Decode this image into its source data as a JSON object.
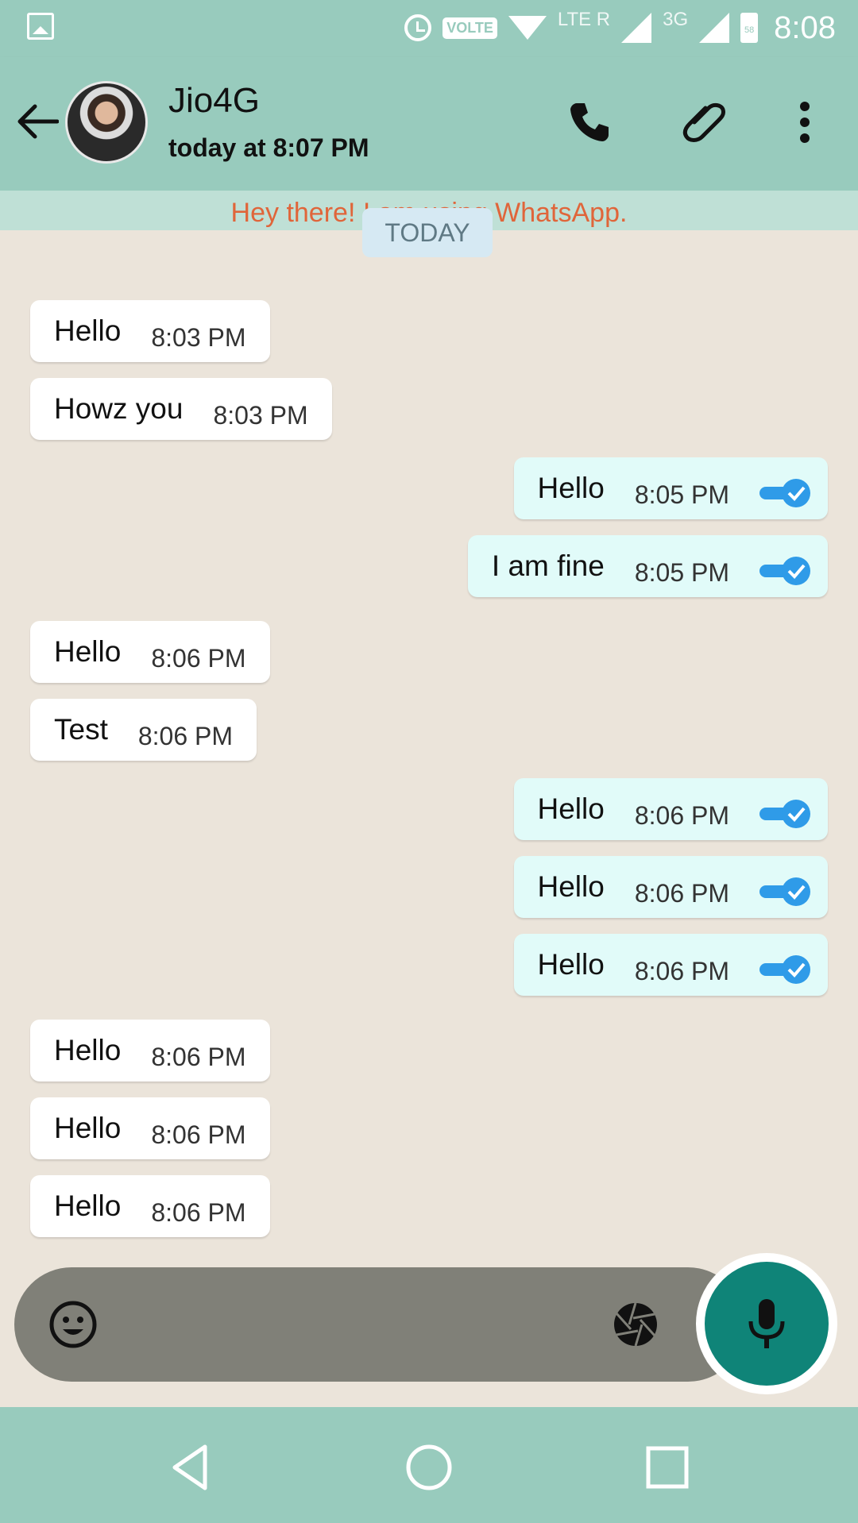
{
  "status_bar": {
    "volte": "VOLTE",
    "lte": "LTE R",
    "network": "3G",
    "battery": "58",
    "time": "8:08"
  },
  "header": {
    "contact_name": "Jio4G",
    "last_seen": "today at 8:07 PM"
  },
  "banner": "Hey there! I am using WhatsApp.",
  "date_chip": "TODAY",
  "messages": [
    {
      "direction": "in",
      "text": "Hello",
      "time": "8:03 PM"
    },
    {
      "direction": "in",
      "text": "Howz you",
      "time": "8:03 PM"
    },
    {
      "direction": "out",
      "text": "Hello",
      "time": "8:05 PM",
      "status": "read"
    },
    {
      "direction": "out",
      "text": "I am fine",
      "time": "8:05 PM",
      "status": "read"
    },
    {
      "direction": "in",
      "text": "Hello",
      "time": "8:06 PM"
    },
    {
      "direction": "in",
      "text": "Test",
      "time": "8:06 PM"
    },
    {
      "direction": "out",
      "text": "Hello",
      "time": "8:06 PM",
      "status": "read"
    },
    {
      "direction": "out",
      "text": "Hello",
      "time": "8:06 PM",
      "status": "read"
    },
    {
      "direction": "out",
      "text": "Hello",
      "time": "8:06 PM",
      "status": "read"
    },
    {
      "direction": "in",
      "text": "Hello",
      "time": "8:06 PM"
    },
    {
      "direction": "in",
      "text": "Hello",
      "time": "8:06 PM"
    },
    {
      "direction": "in",
      "text": "Hello",
      "time": "8:06 PM"
    }
  ],
  "colors": {
    "header": "#98cbbd",
    "banner_text": "#e0653a",
    "incoming_bubble": "#ffffff",
    "outgoing_bubble": "#e1fbf9",
    "read_check": "#2f9be8",
    "mic_button": "#0f8478"
  }
}
